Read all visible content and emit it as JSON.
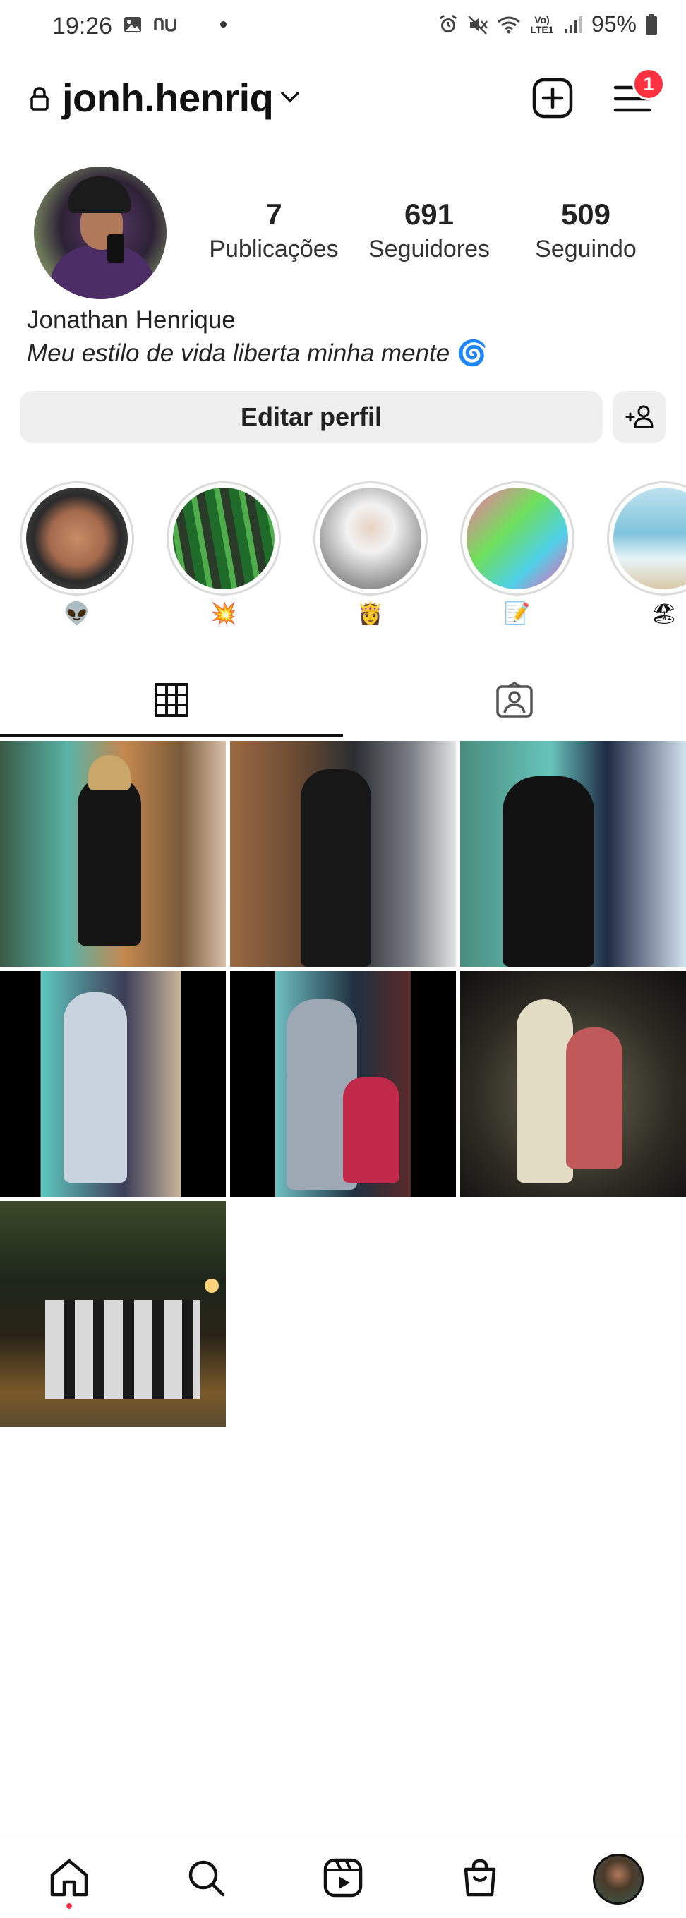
{
  "status_bar": {
    "time": "19:26",
    "left_icons": [
      "gallery-icon",
      "nubank-icon"
    ],
    "battery": "95%",
    "network": "Vo) LTE1",
    "right_icons": [
      "alarm-icon",
      "mute-icon",
      "wifi-icon",
      "signal-icon",
      "battery-icon"
    ]
  },
  "header": {
    "username": "jonh.henriq",
    "notifications_count": "1",
    "icons": [
      "lock-icon",
      "chevron-down-icon",
      "new-post-icon",
      "menu-icon"
    ]
  },
  "profile": {
    "stats": [
      {
        "value": "7",
        "label": "Publicações"
      },
      {
        "value": "691",
        "label": "Seguidores"
      },
      {
        "value": "509",
        "label": "Seguindo"
      }
    ],
    "full_name": "Jonathan Henrique",
    "bio": "Meu estilo de vida liberta minha mente",
    "bio_emoji": "🌀",
    "edit_button": "Editar perfil",
    "discover_icon": "add-person-icon"
  },
  "highlights": [
    {
      "emoji": "👽"
    },
    {
      "emoji": "💥"
    },
    {
      "emoji": "👸"
    },
    {
      "emoji": "📝"
    },
    {
      "emoji": "🏖"
    }
  ],
  "tabs": [
    {
      "icon": "grid-icon",
      "active": true
    },
    {
      "icon": "tagged-icon",
      "active": false
    }
  ],
  "posts_count": 7,
  "bottom_nav": [
    "home-icon",
    "search-icon",
    "reels-icon",
    "shop-icon",
    "profile-avatar"
  ],
  "colors": {
    "badge": "#ff3040",
    "button_bg": "#efefef",
    "divider": "#dbdbdb",
    "text": "#111111"
  }
}
